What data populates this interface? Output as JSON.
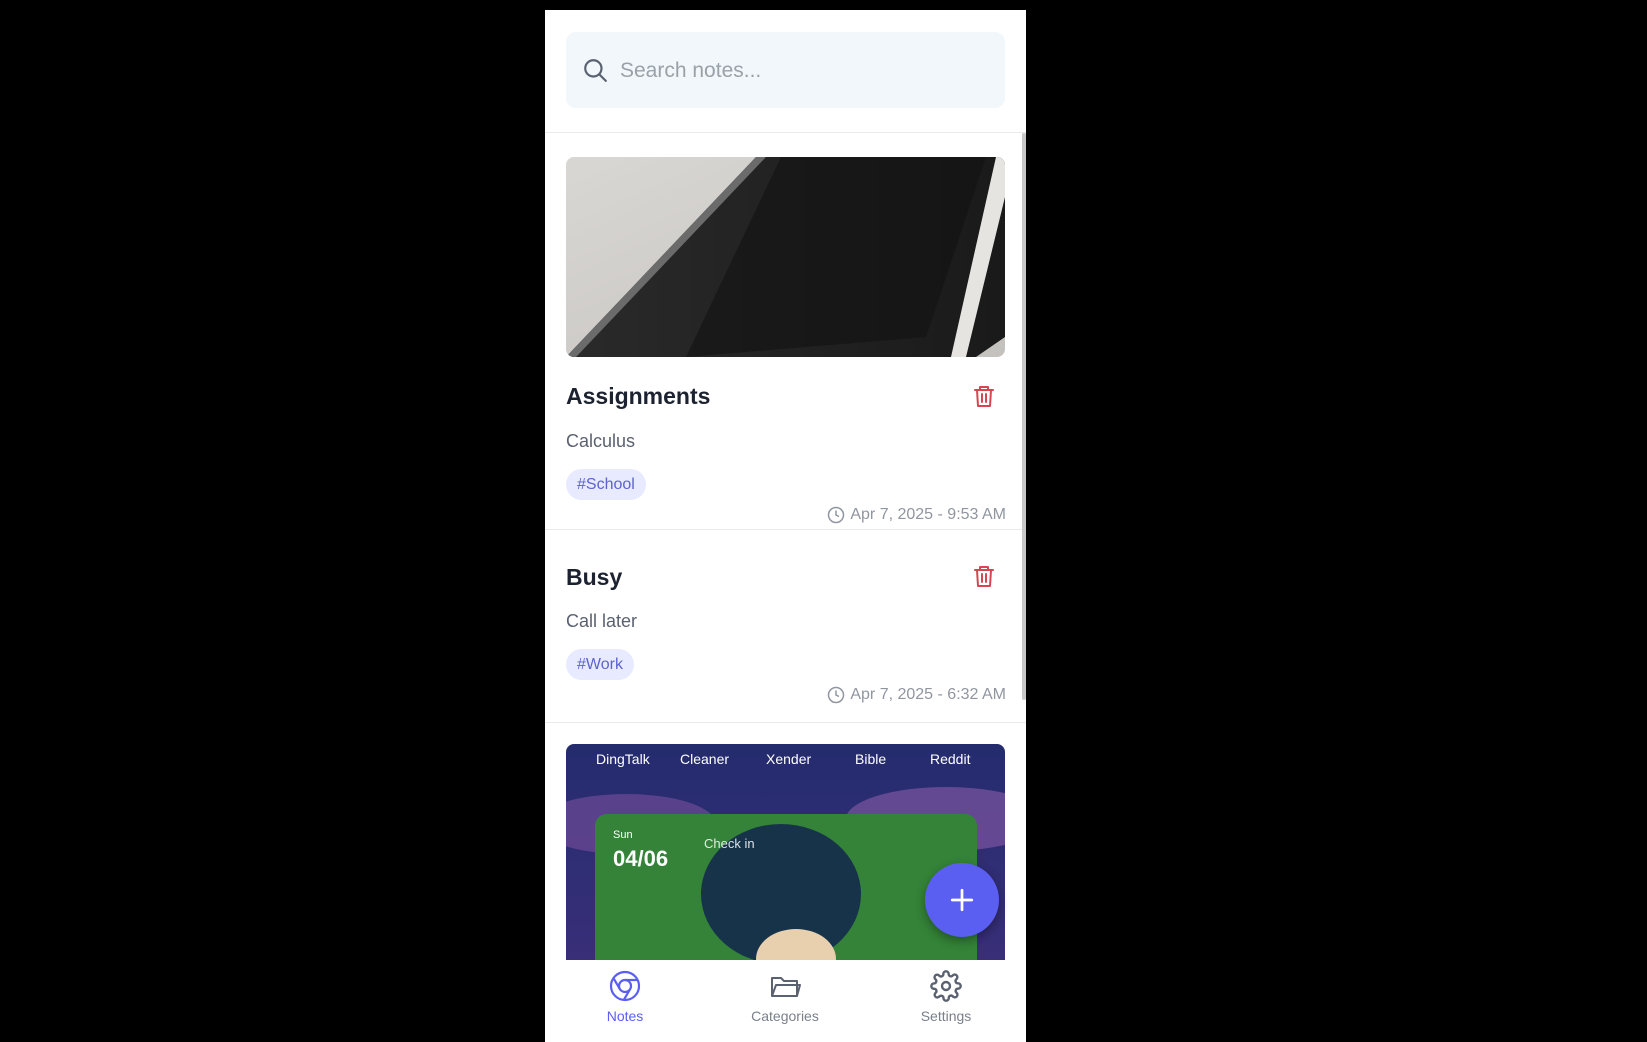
{
  "search": {
    "placeholder": "Search notes..."
  },
  "notes": [
    {
      "title": "Assignments",
      "body": "Calculus",
      "tag": "#School",
      "timestamp": "Apr 7, 2025 - 9:53 AM"
    },
    {
      "title": "Busy",
      "body": "Call later",
      "tag": "#Work",
      "timestamp": "Apr 7, 2025 - 6:32 AM"
    }
  ],
  "third_note_image": {
    "apps": [
      "DingTalk",
      "Cleaner",
      "Xender",
      "Bible",
      "Reddit"
    ],
    "widget_day": "Sun",
    "widget_date": "04/06",
    "widget_checkin": "Check in"
  },
  "fab": {
    "icon": "plus-icon"
  },
  "bottom_nav": [
    {
      "label": "Notes",
      "icon": "notes-icon",
      "active": true
    },
    {
      "label": "Categories",
      "icon": "folder-icon",
      "active": false
    },
    {
      "label": "Settings",
      "icon": "gear-icon",
      "active": false
    }
  ],
  "colors": {
    "accent": "#5a5ff2",
    "delete": "#d64550",
    "tag_bg": "#e8eaff",
    "tag_text": "#5c63cf"
  }
}
